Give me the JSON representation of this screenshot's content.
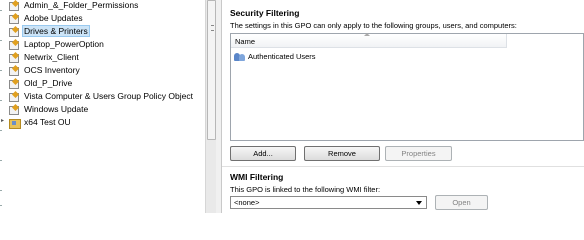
{
  "tree": {
    "items": [
      {
        "label": "Admin_&_Folder_Permissions",
        "icon": "gpo-link-icon",
        "selected": false
      },
      {
        "label": "Adobe Updates",
        "icon": "gpo-link-icon",
        "selected": false
      },
      {
        "label": "Drives & Printers",
        "icon": "gpo-link-icon",
        "selected": true
      },
      {
        "label": "Laptop_PowerOption",
        "icon": "gpo-link-icon",
        "selected": false
      },
      {
        "label": "Netwrix_Client",
        "icon": "gpo-link-icon",
        "selected": false
      },
      {
        "label": "OCS Inventory",
        "icon": "gpo-link-icon",
        "selected": false
      },
      {
        "label": "Old_P_Drive",
        "icon": "gpo-link-icon",
        "selected": false
      },
      {
        "label": "Vista Computer & Users Group Policy Object",
        "icon": "gpo-link-icon",
        "selected": false
      },
      {
        "label": "Windows Update",
        "icon": "gpo-link-icon",
        "selected": false
      },
      {
        "label": "x64 Test OU",
        "icon": "organizational-unit-icon",
        "selected": false
      }
    ]
  },
  "security_filtering": {
    "title": "Security Filtering",
    "description": "The settings in this GPO can only apply to the following groups, users, and computers:",
    "column_header": "Name",
    "entries": [
      "Authenticated Users"
    ],
    "add_label": "Add...",
    "remove_label": "Remove",
    "properties_label": "Properties"
  },
  "wmi_filtering": {
    "title": "WMI Filtering",
    "description": "This GPO is linked to the following WMI filter:",
    "selected_filter": "<none>",
    "open_label": "Open"
  },
  "colors": {
    "selection_bg": "#cce4f7",
    "selection_border": "#99c9ef",
    "button_border": "#707070"
  }
}
